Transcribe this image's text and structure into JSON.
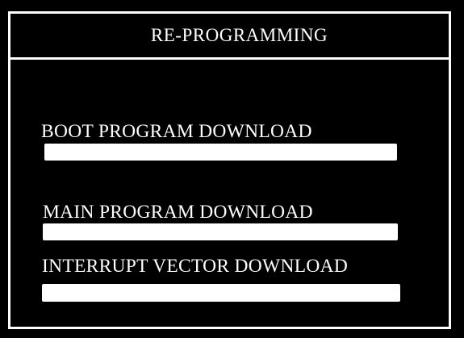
{
  "window": {
    "title": "RE-PROGRAMMING"
  },
  "steps": [
    {
      "label": "BOOT PROGRAM DOWNLOAD",
      "progress": 1.0
    },
    {
      "label": "MAIN PROGRAM DOWNLOAD",
      "progress": 1.0
    },
    {
      "label": "INTERRUPT VECTOR DOWNLOAD",
      "progress": 1.0
    }
  ],
  "colors": {
    "background": "#000000",
    "foreground": "#ffffff"
  }
}
